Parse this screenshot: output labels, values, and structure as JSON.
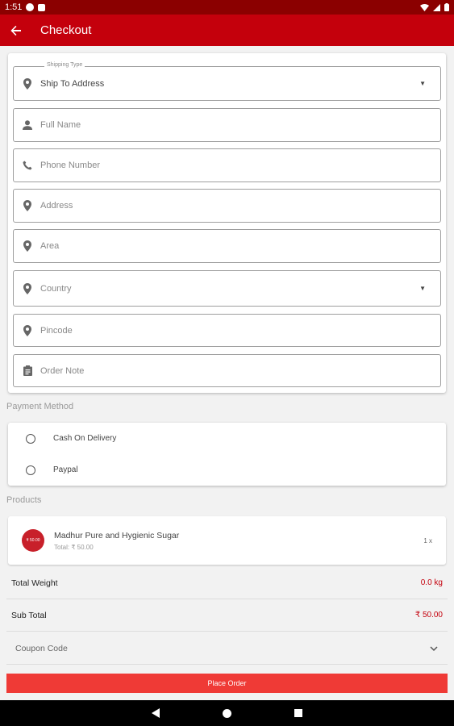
{
  "status_bar": {
    "time": "1:51"
  },
  "app_bar": {
    "title": "Checkout",
    "back_icon": "arrow-left-icon"
  },
  "shipping": {
    "type_label": "Shipping Type",
    "type_value": "Ship To Address",
    "full_name_placeholder": "Full Name",
    "phone_placeholder": "Phone Number",
    "address_placeholder": "Address",
    "area_placeholder": "Area",
    "country_placeholder": "Country",
    "pincode_placeholder": "Pincode",
    "order_note_placeholder": "Order Note"
  },
  "payment": {
    "section_label": "Payment Method",
    "options": [
      {
        "label": "Cash On Delivery",
        "selected": false
      },
      {
        "label": "Paypal",
        "selected": false
      }
    ]
  },
  "products": {
    "section_label": "Products",
    "items": [
      {
        "thumb_text": "₹ 50.00",
        "name": "Madhur Pure and Hygienic Sugar",
        "total": "Total: ₹ 50.00",
        "qty": "1 x"
      }
    ]
  },
  "summary": {
    "total_weight_label": "Total Weight",
    "total_weight_value": "0.0 kg",
    "sub_total_label": "Sub Total",
    "sub_total_value": "₹ 50.00",
    "coupon_label": "Coupon Code"
  },
  "place_order_label": "Place Order",
  "colors": {
    "primary": "#c4000c",
    "status_bar": "#8b0000",
    "button": "#ef3a36"
  }
}
